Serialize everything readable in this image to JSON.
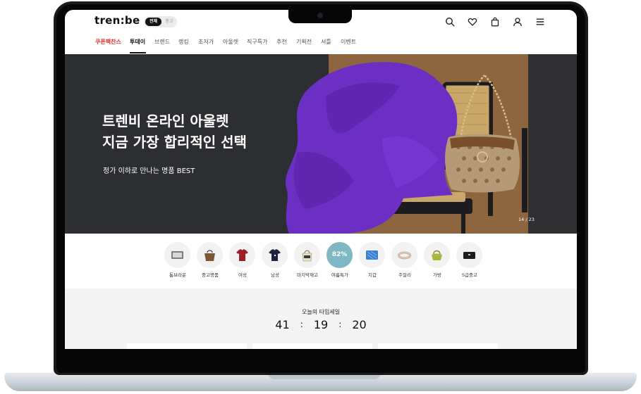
{
  "header": {
    "logo": "tren:be",
    "mode_active": "전체",
    "mode_inactive": "중고"
  },
  "nav": {
    "items": [
      "쿠폰팩찬스",
      "투데이",
      "브랜드",
      "랭킹",
      "초저가",
      "아울렛",
      "직구특가",
      "추천",
      "기획전",
      "셔틀",
      "이벤트"
    ],
    "active_index": 1,
    "highlight_index": 0
  },
  "hero": {
    "title_line1": "트렌비 온라인 아울렛",
    "title_line2": "지금 가장 합리적인 선택",
    "subtitle": "정가 이하로 만나는 명품 BEST",
    "counter": "14 / 23"
  },
  "categories": [
    {
      "label": "톰브라운",
      "icon": "card-wallet-icon"
    },
    {
      "label": "중고명품",
      "icon": "tote-bag-icon"
    },
    {
      "label": "여성",
      "icon": "red-tshirt-icon"
    },
    {
      "label": "남성",
      "icon": "navy-tshirt-icon"
    },
    {
      "label": "마지막재고",
      "icon": "basket-bag-icon"
    },
    {
      "label": "여름특가",
      "icon": "discount-badge-icon",
      "badge": "82%"
    },
    {
      "label": "지갑",
      "icon": "blue-wallet-icon"
    },
    {
      "label": "주얼리",
      "icon": "bracelet-icon"
    },
    {
      "label": "가방",
      "icon": "green-handbag-icon"
    },
    {
      "label": "S급중고",
      "icon": "black-clutch-icon"
    }
  ],
  "timesale": {
    "title": "오늘의 타임세일",
    "hours": "41",
    "minutes": "19",
    "seconds": "20",
    "separator": ":"
  },
  "colors": {
    "accent_red": "#e0302f",
    "badge_teal": "#7fb8c4",
    "hero_dark": "#2d2e31",
    "hero_purple": "#6b2fc4"
  }
}
